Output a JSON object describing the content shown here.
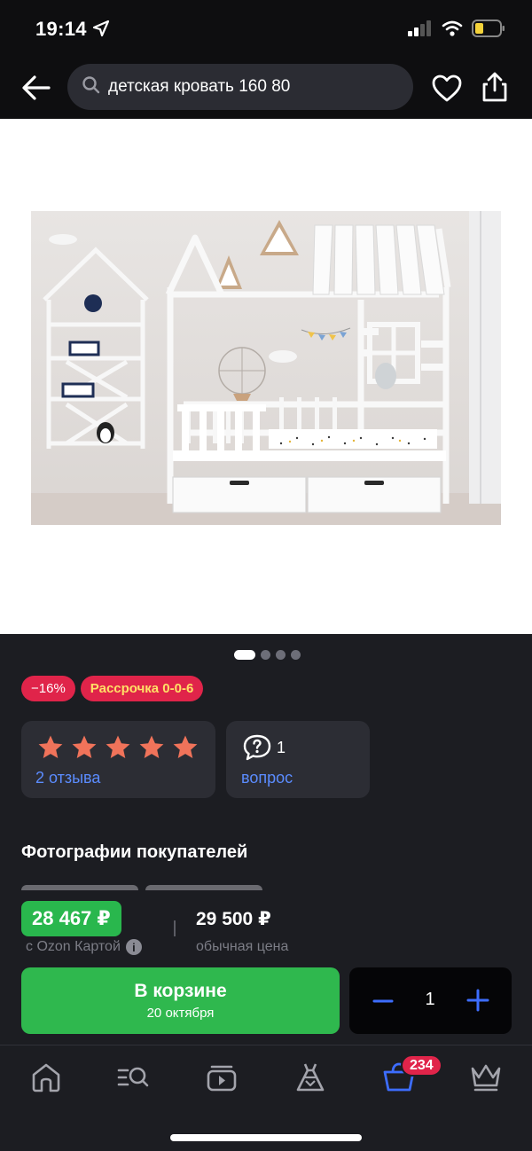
{
  "status_bar": {
    "time": "19:14"
  },
  "search": {
    "query": "детская кровать 160 80"
  },
  "gallery": {
    "photo_alt": "Фото товара",
    "page_count": 4,
    "active_page": 1
  },
  "badges": {
    "discount": "−16%",
    "installment": "Рассрочка 0-0-6"
  },
  "rating": {
    "stars": 5,
    "reviews_label": "2 отзыва"
  },
  "questions": {
    "count": "1",
    "label": "вопрос"
  },
  "customer_photos": {
    "title": "Фотографии покупателей"
  },
  "price": {
    "ozon_card_price": "28 467 ₽",
    "ozon_card_note": "с Ozon Картой",
    "regular_price": "29 500 ₽",
    "regular_note": "обычная цена"
  },
  "cart": {
    "button_label": "В корзине",
    "delivery_date": "20 октября",
    "quantity": "1"
  },
  "tabbar": {
    "items": [
      "home-icon",
      "catalog-icon",
      "video-icon",
      "fresh-icon",
      "cart-icon",
      "premium-icon"
    ],
    "cart_count": "234",
    "active_accent": "#3d6dff"
  },
  "colors": {
    "accent_blue": "#5b8cff",
    "green": "#2fb84e",
    "red_badge": "#e0244a",
    "star": "#f0735a"
  }
}
